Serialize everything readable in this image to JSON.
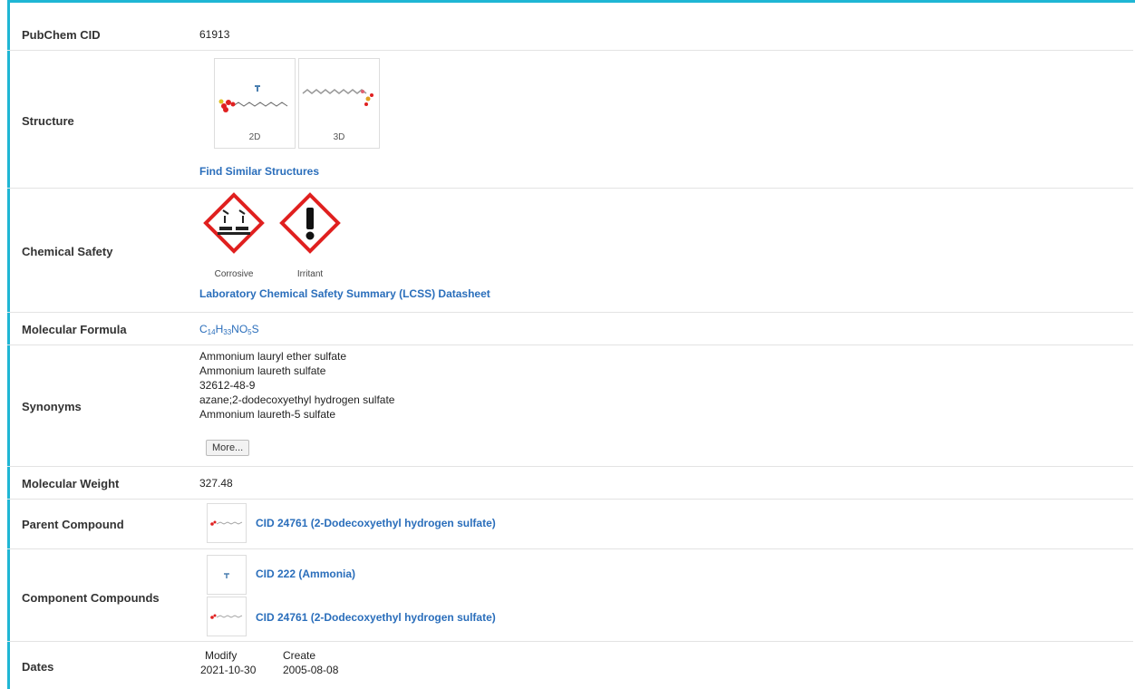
{
  "rows": {
    "cid": {
      "label": "PubChem CID",
      "value": "61913"
    },
    "structure": {
      "label": "Structure",
      "thumb_2d": "2D",
      "thumb_3d": "3D",
      "link": "Find Similar Structures"
    },
    "safety": {
      "label": "Chemical Safety",
      "pictograms": [
        "Corrosive",
        "Irritant"
      ],
      "link": "Laboratory Chemical Safety Summary (LCSS) Datasheet"
    },
    "formula": {
      "label": "Molecular Formula",
      "parts": [
        {
          "t": "C"
        },
        {
          "s": "14"
        },
        {
          "t": "H"
        },
        {
          "s": "33"
        },
        {
          "t": "NO"
        },
        {
          "s": "5"
        },
        {
          "t": "S"
        }
      ]
    },
    "synonyms": {
      "label": "Synonyms",
      "items": [
        "Ammonium lauryl ether sulfate",
        "Ammonium laureth sulfate",
        "32612-48-9",
        "azane;2-dodecoxyethyl hydrogen sulfate",
        "Ammonium laureth-5 sulfate"
      ],
      "more_button": "More..."
    },
    "weight": {
      "label": "Molecular Weight",
      "value": "327.48"
    },
    "parent": {
      "label": "Parent Compound",
      "link": "CID 24761 (2-Dodecoxyethyl hydrogen sulfate)"
    },
    "components": {
      "label": "Component Compounds",
      "links": [
        "CID 222 (Ammonia)",
        "CID 24761 (2-Dodecoxyethyl hydrogen sulfate)"
      ]
    },
    "dates": {
      "label": "Dates",
      "modify_label": "Modify",
      "create_label": "Create",
      "modify_value": "2021-10-30",
      "create_value": "2005-08-08"
    }
  },
  "colors": {
    "accent_border": "#1fb6d4",
    "link": "#2a6ebb",
    "hazard_red": "#e0201f"
  }
}
